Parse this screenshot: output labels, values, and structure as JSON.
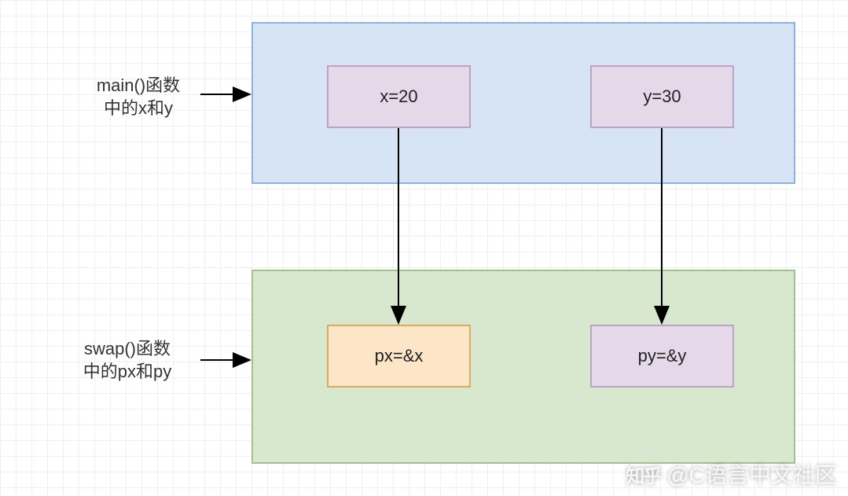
{
  "diagram": {
    "main_container": {
      "label_line1": "main()函数",
      "label_line2": "中的x和y",
      "nodes": {
        "x": "x=20",
        "y": "y=30"
      }
    },
    "swap_container": {
      "label_line1": "swap()函数",
      "label_line2": "中的px和py",
      "nodes": {
        "px": "px=&x",
        "py": "py=&y"
      }
    }
  },
  "watermark": {
    "logo": "知乎",
    "text": "@C语言中文社区"
  }
}
